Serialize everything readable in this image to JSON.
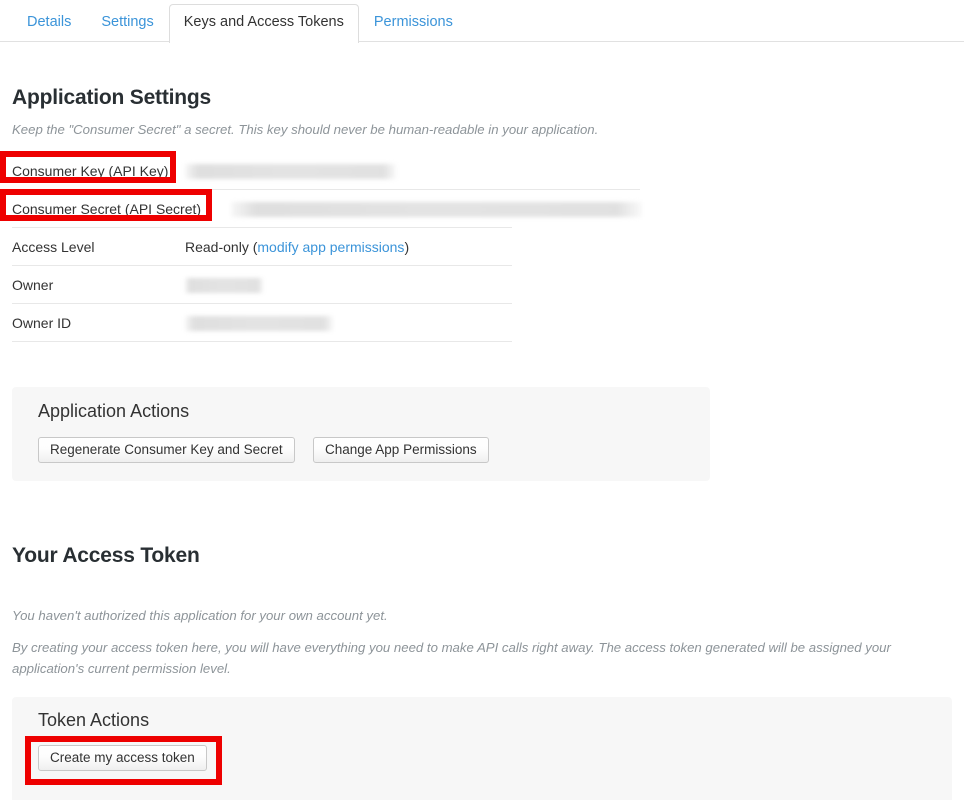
{
  "tabs": [
    {
      "label": "Details",
      "active": false
    },
    {
      "label": "Settings",
      "active": false
    },
    {
      "label": "Keys and Access Tokens",
      "active": true
    },
    {
      "label": "Permissions",
      "active": false
    }
  ],
  "application_settings": {
    "heading": "Application Settings",
    "note": "Keep the \"Consumer Secret\" a secret. This key should never be human-readable in your application.",
    "rows": [
      {
        "label": "Consumer Key (API Key)",
        "value": "",
        "redacted": true,
        "redacted_width": 211
      },
      {
        "label": "Consumer Secret (API Secret)",
        "value": "",
        "redacted": true,
        "redacted_width": 411
      },
      {
        "label": "Access Level",
        "value": "Read-only (",
        "link": "modify app permissions",
        "value_suffix": ")",
        "redacted": false
      },
      {
        "label": "Owner",
        "value": "",
        "redacted": true,
        "redacted_width": 78
      },
      {
        "label": "Owner ID",
        "value": "",
        "redacted": true,
        "redacted_width": 148
      }
    ]
  },
  "application_actions": {
    "title": "Application Actions",
    "buttons": [
      {
        "label": "Regenerate Consumer Key and Secret"
      },
      {
        "label": "Change App Permissions"
      }
    ]
  },
  "access_token": {
    "heading": "Your Access Token",
    "status": "You haven't authorized this application for your own account yet.",
    "description": "By creating your access token here, you will have everything you need to make API calls right away. The access token generated will be assigned your application's current permission level."
  },
  "token_actions": {
    "title": "Token Actions",
    "buttons": [
      {
        "label": "Create my access token"
      }
    ]
  },
  "annotations": {
    "color": "#ee0000",
    "boxes": [
      {
        "target": "consumer-key-label"
      },
      {
        "target": "consumer-secret-label"
      },
      {
        "target": "create-my-access-token-button"
      }
    ]
  }
}
